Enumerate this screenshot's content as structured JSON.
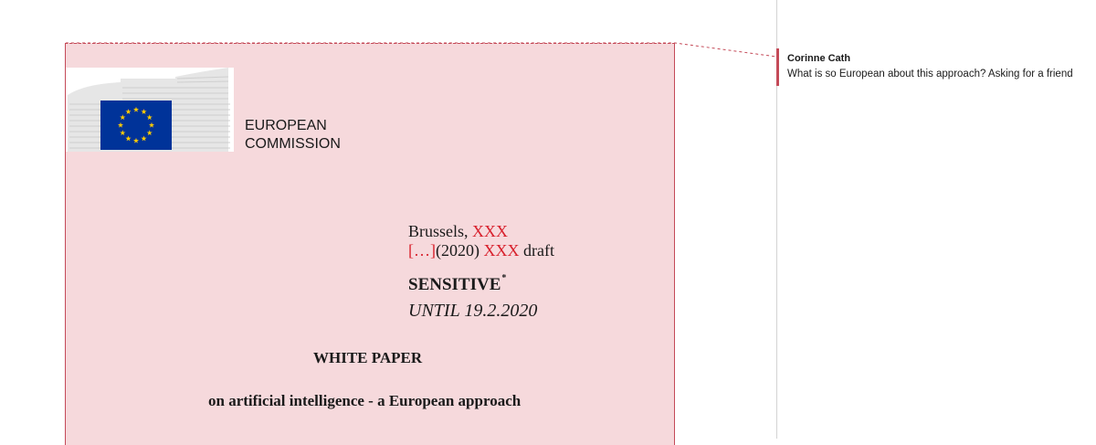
{
  "document": {
    "logo": {
      "line1": "EUROPEAN",
      "line2": "COMMISSION",
      "flag_color": "#003399",
      "star_color": "#FFCC00"
    },
    "brussels_prefix": "Brussels, ",
    "brussels_placeholder": "XXX",
    "reference_bracket": "[…]",
    "reference_year": "(2020) ",
    "reference_placeholder": "XXX",
    "reference_suffix": " draft",
    "sensitivity_label": "SENSITIVE",
    "sensitivity_marker": "*",
    "embargo": "UNTIL 19.2.2020",
    "doc_type": "WHITE PAPER",
    "title": "on artificial intelligence - a European approach",
    "highlight_color": "#F6D9DC",
    "placeholder_color": "#D8212D"
  },
  "comment": {
    "author": "Corinne Cath",
    "text": "What is so European about this approach? Asking for a friend",
    "accent_color": "#C44A58"
  }
}
